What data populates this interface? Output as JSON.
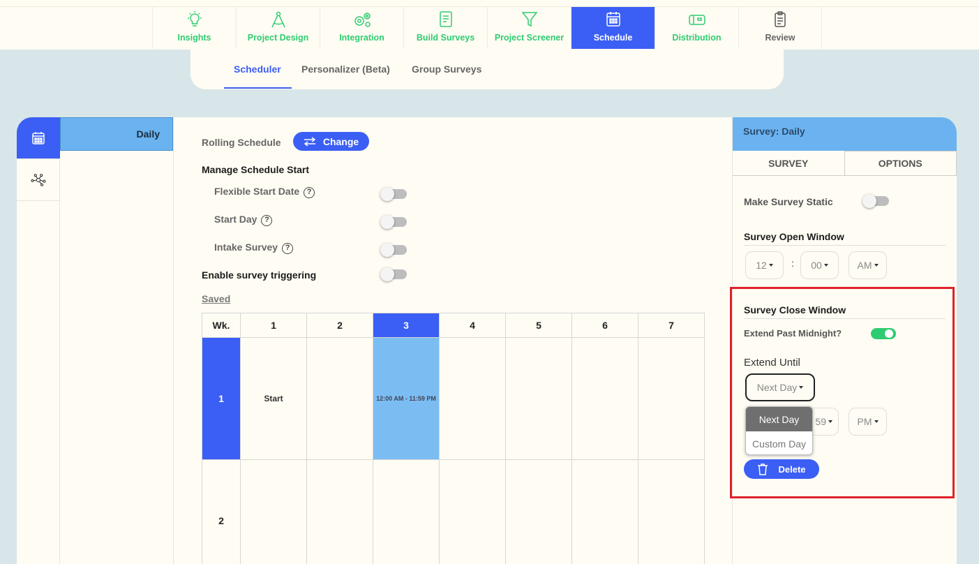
{
  "topnav": {
    "items": [
      {
        "label": "Insights",
        "icon": "lightbulb-icon"
      },
      {
        "label": "Project Design",
        "icon": "compass-icon"
      },
      {
        "label": "Integration",
        "icon": "gears-icon"
      },
      {
        "label": "Build Surveys",
        "icon": "form-icon"
      },
      {
        "label": "Project Screener",
        "icon": "funnel-icon"
      },
      {
        "label": "Schedule",
        "icon": "calendar-icon",
        "active": true
      },
      {
        "label": "Distribution",
        "icon": "mailbox-icon"
      },
      {
        "label": "Review",
        "icon": "clipboard-icon"
      }
    ]
  },
  "subtabs": [
    "Scheduler",
    "Personalizer (Beta)",
    "Group Surveys"
  ],
  "sidebar": {
    "schedule_item": "Daily"
  },
  "schedule": {
    "rolling_label": "Rolling Schedule",
    "change_label": "Change",
    "manage_start": "Manage Schedule Start",
    "flexible_start": "Flexible Start Date",
    "start_day": "Start Day",
    "intake_survey": "Intake Survey",
    "enable_triggering": "Enable survey triggering",
    "saved": "Saved",
    "qmark": "?"
  },
  "grid": {
    "corner": "Wk.",
    "days": [
      "1",
      "2",
      "3",
      "4",
      "5",
      "6",
      "7"
    ],
    "weeks": [
      "1",
      "2"
    ],
    "start_label": "Start",
    "window_label": "12:00 AM - 11:59 PM"
  },
  "right": {
    "header": "Survey: Daily",
    "tab_survey": "SURVEY",
    "tab_options": "OPTIONS",
    "make_static": "Make Survey Static",
    "open_window": "Survey Open Window",
    "open_hour": "12",
    "open_min": "00",
    "open_ampm": "AM",
    "close_window": "Survey Close Window",
    "extend_midnight": "Extend Past Midnight?",
    "extend_until": "Extend Until",
    "extend_value": "Next Day",
    "close_min": "59",
    "close_ampm": "PM",
    "dropdown_options": [
      "Next Day",
      "Custom Day"
    ],
    "delete_label": "Delete",
    "colon": ":"
  },
  "colors": {
    "accent": "#3b5ef5",
    "green": "#2ecc71",
    "highlight": "#e0212b"
  }
}
